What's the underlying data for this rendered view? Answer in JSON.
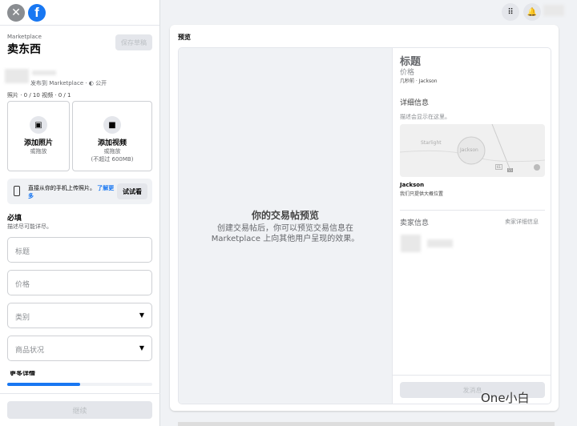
{
  "left": {
    "subtitle": "Marketplace",
    "title": "卖东西",
    "save_draft": "保存草稿",
    "publish_info": "发布到 Marketplace · ◐ 公开",
    "media_count": "照片 · 0 / 10 视频 · 0 / 1",
    "add_photo": "添加照片",
    "add_photo_sub": "或拖放",
    "add_video": "添加视频",
    "add_video_sub": "或拖放",
    "add_video_limit": "(不超过 600MB)",
    "phone_upload": "直接从你的手机上传照片。",
    "learn_more": "了解更多",
    "try_it": "试试看",
    "required": "必填",
    "required_sub": "描述尽可能详尽。",
    "fields": {
      "title": "标题",
      "price": "价格",
      "category": "类别",
      "condition": "商品状况"
    },
    "more_details": "更多详情",
    "progress_percent": 50,
    "continue": "继续"
  },
  "preview": {
    "label": "预览",
    "empty_title": "你的交易帖预览",
    "empty_desc": "创建交易帖后，你可以预览交易信息在 Marketplace 上向其他用户呈现的效果。",
    "title": "标题",
    "price": "价格",
    "meta": "几秒前 · Jackson",
    "details_heading": "详细信息",
    "details_placeholder": "描述会显示在这里。",
    "map": {
      "label_starlight": "Starlight",
      "label_jackson": "Jackson",
      "route1": "61",
      "route2": "55"
    },
    "location": "Jackson",
    "location_note": "我们只提供大概位置",
    "seller_heading": "卖家信息",
    "seller_details": "卖家详细信息",
    "send": "发消息"
  },
  "watermark": "One小白",
  "colors": {
    "accent": "#1877f2",
    "bg": "#f0f2f5"
  }
}
